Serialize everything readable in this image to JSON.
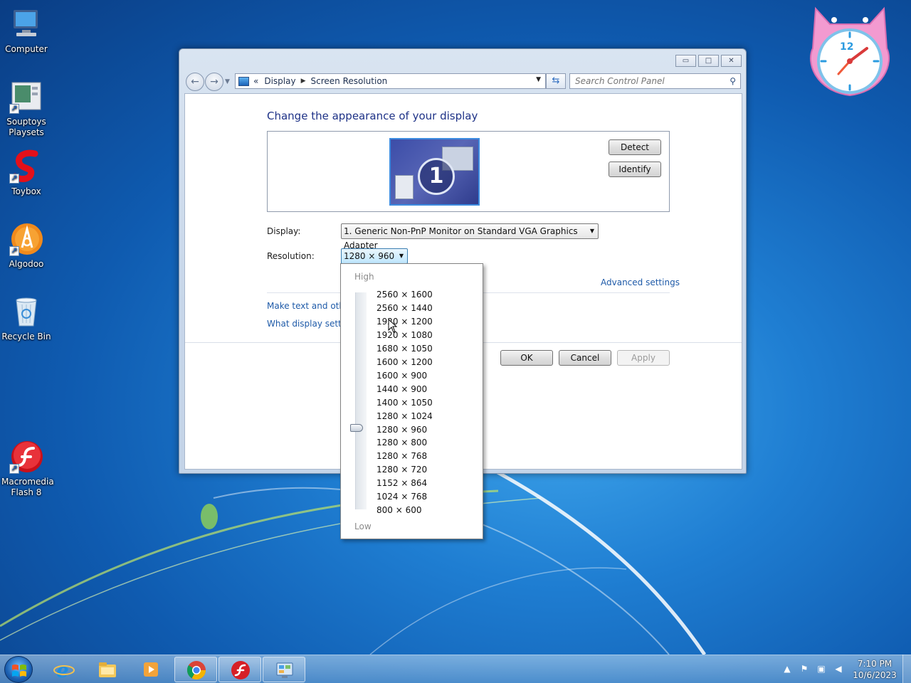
{
  "desktop": {
    "icons": [
      {
        "label": "Computer"
      },
      {
        "label": "Souptoys Playsets"
      },
      {
        "label": "Toybox"
      },
      {
        "label": "Algodoo"
      },
      {
        "label": "Recycle Bin"
      },
      {
        "label": "Macromedia Flash 8"
      }
    ],
    "gadget_clock_numeral": "12"
  },
  "window": {
    "caption": {
      "minimize": "▭",
      "maximize": "□",
      "close": "✕"
    },
    "address": {
      "overflow": "«",
      "crumbs": [
        "Display",
        "Screen Resolution"
      ]
    },
    "search_placeholder": "Search Control Panel",
    "title": "Change the appearance of your display",
    "monitor_number": "1",
    "detect_label": "Detect",
    "identify_label": "Identify",
    "display_label": "Display:",
    "display_value": "1. Generic Non-PnP Monitor on Standard VGA Graphics Adapter",
    "resolution_label": "Resolution:",
    "resolution_value": "1280 × 960",
    "advanced_link": "Advanced settings",
    "link_text_size": "Make text and other",
    "link_display_settings": "What display setting",
    "ok_label": "OK",
    "cancel_label": "Cancel",
    "apply_label": "Apply"
  },
  "resolution_dropdown": {
    "high_label": "High",
    "low_label": "Low",
    "options": [
      "2560 × 1600",
      "2560 × 1440",
      "1920 × 1200",
      "1920 × 1080",
      "1680 × 1050",
      "1600 × 1200",
      "1600 × 900",
      "1440 × 900",
      "1400 × 1050",
      "1280 × 1024",
      "1280 × 960",
      "1280 × 800",
      "1280 × 768",
      "1280 × 720",
      "1152 × 864",
      "1024 × 768",
      "800 × 600"
    ],
    "selected": "1280 × 960"
  },
  "taskbar": {
    "time": "7:10 PM",
    "date": "10/6/2023",
    "pinned": [
      "internet-explorer",
      "file-explorer",
      "media-player",
      "chrome",
      "flash",
      "control-panel"
    ]
  },
  "colors": {
    "link": "#1e5aa8",
    "title": "#1e3287",
    "desktop": "#1f7ed2"
  }
}
